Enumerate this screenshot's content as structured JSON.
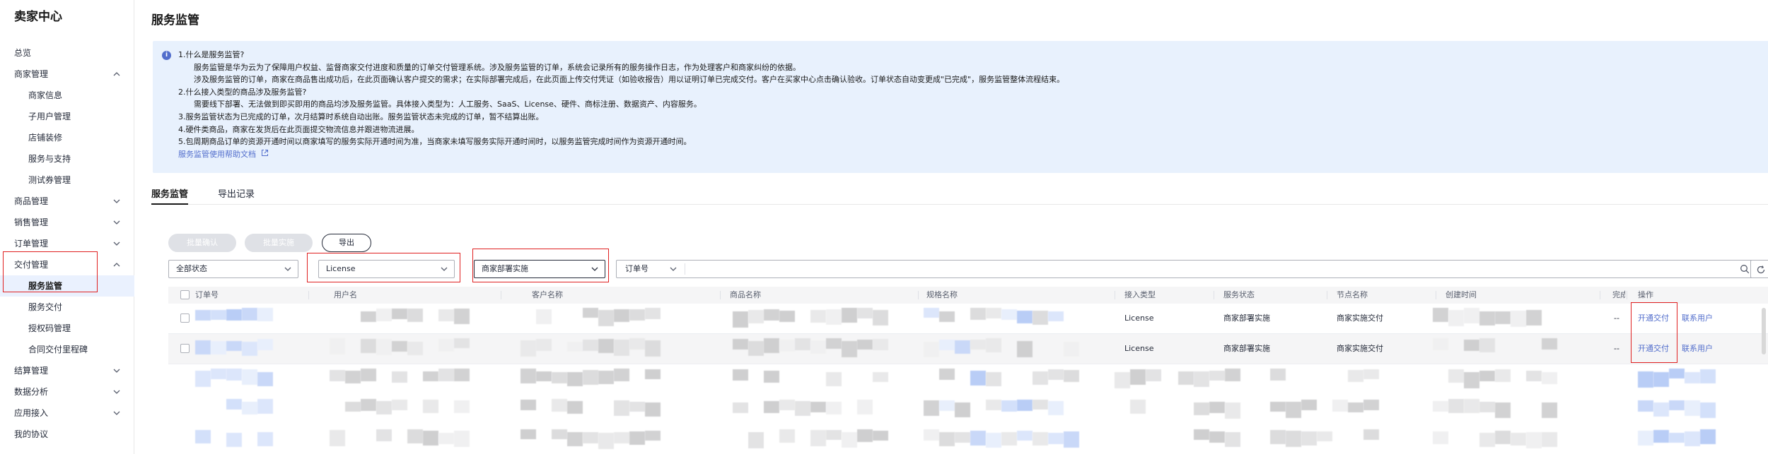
{
  "sidebar": {
    "title": "卖家中心",
    "items": [
      {
        "label": "总览"
      },
      {
        "label": "商家管理"
      },
      {
        "label": "商家信息"
      },
      {
        "label": "子用户管理"
      },
      {
        "label": "店铺装修"
      },
      {
        "label": "服务与支持"
      },
      {
        "label": "测试券管理"
      },
      {
        "label": "商品管理"
      },
      {
        "label": "销售管理"
      },
      {
        "label": "订单管理"
      },
      {
        "label": "交付管理"
      },
      {
        "label": "服务监管"
      },
      {
        "label": "服务交付"
      },
      {
        "label": "授权码管理"
      },
      {
        "label": "合同交付里程碑"
      },
      {
        "label": "结算管理"
      },
      {
        "label": "数据分析"
      },
      {
        "label": "应用接入"
      },
      {
        "label": "我的协议"
      }
    ]
  },
  "page": {
    "title": "服务监管"
  },
  "notice": {
    "lines": [
      "1.什么是服务监管?",
      "服务监管是华为云为了保障用户权益、监督商家交付进度和质量的订单交付管理系统。涉及服务监管的订单，系统会记录所有的服务操作日志，作为处理客户和商家纠纷的依据。",
      "涉及服务监管的订单，商家在商品售出成功后，在此页面确认客户提交的需求；在实际部署完成后，在此页面上传交付凭证（如验收报告）用以证明订单已完成交付。客户在买家中心点击确认验收。订单状态自动变更成\"已完成\"，服务监管整体流程结束。",
      "2.什么接入类型的商品涉及服务监管?",
      "需要线下部署、无法做到即买即用的商品均涉及服务监管。具体接入类型为：人工服务、SaaS、License、硬件、商标注册、数据资产、内容服务。",
      "3.服务监管状态为已完成的订单，次月结算时系统自动出账。服务监管状态未完成的订单，暂不结算出账。",
      "4.硬件类商品，商家在发货后在此页面提交物流信息并跟进物流进展。",
      "5.包周期商品订单的资源开通时间以商家填写的服务实际开通时间为准，当商家未填写服务实际开通时间时，以服务监管完成时间作为资源开通时间。"
    ],
    "help_link": "服务监管使用帮助文档"
  },
  "tabs": [
    {
      "label": "服务监管"
    },
    {
      "label": "导出记录"
    }
  ],
  "toolbar": {
    "batch_confirm": "批量确认",
    "batch_implement": "批量实施",
    "export": "导出"
  },
  "filters": {
    "status": "全部状态",
    "access_type": "License",
    "service_status": "商家部署实施",
    "search_field": "订单号",
    "search_value": ""
  },
  "table": {
    "columns": [
      "订单号",
      "用户名",
      "客户名称",
      "商品名称",
      "规格名称",
      "接入类型",
      "服务状态",
      "节点名称",
      "创建时间",
      "完成",
      "操作"
    ],
    "rows": [
      {
        "access_type": "License",
        "service_status": "商家部署实施",
        "node": "商家实施交付",
        "done": "--",
        "action_primary": "开通交付",
        "action_secondary": "联系用户"
      },
      {
        "access_type": "License",
        "service_status": "商家部署实施",
        "node": "商家实施交付",
        "done": "--",
        "action_primary": "开通交付",
        "action_secondary": "联系用户"
      }
    ]
  },
  "colors": {
    "accent": "#526ecc",
    "highlight": "#e02020",
    "notice_bg": "#e8f1fd",
    "active_nav_bg": "#eaf1fe"
  }
}
